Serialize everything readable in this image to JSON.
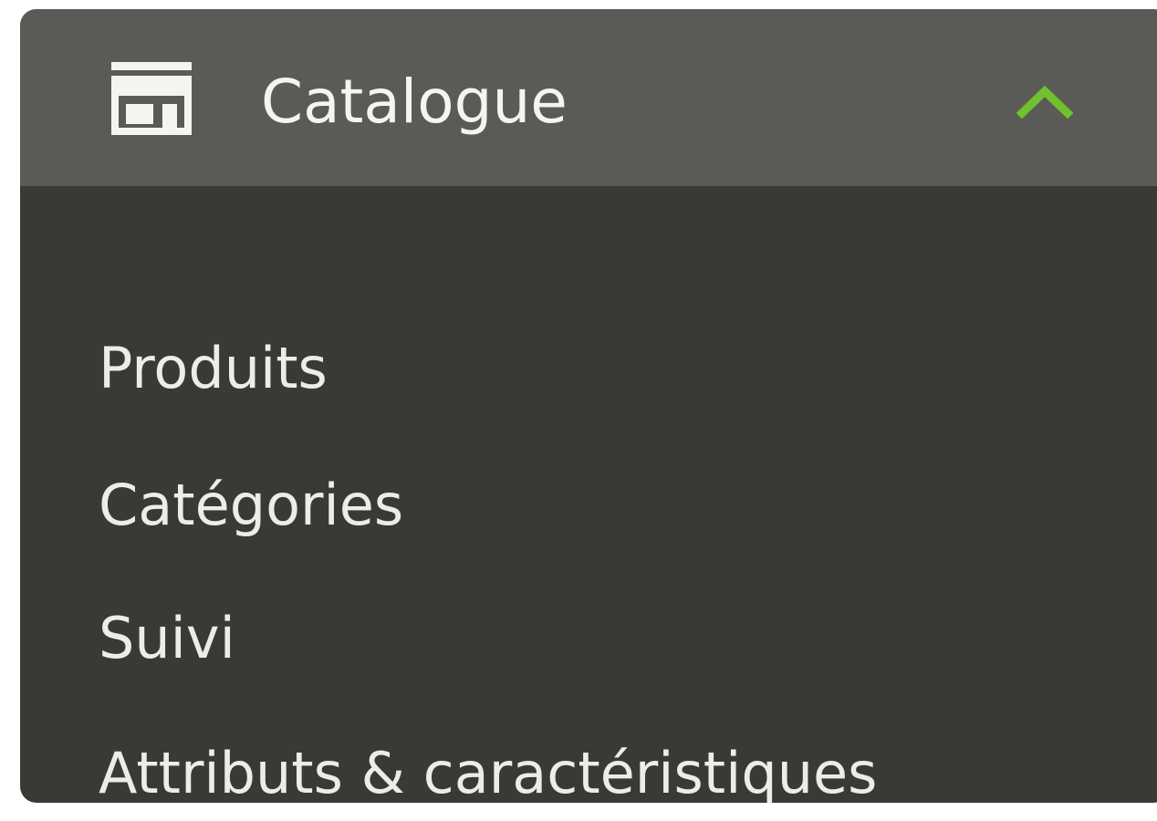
{
  "menu": {
    "header": {
      "label": "Catalogue",
      "icon": "store-icon",
      "toggle_icon": "chevron-up-icon",
      "expanded": true
    },
    "items": [
      {
        "label": "Produits"
      },
      {
        "label": "Catégories"
      },
      {
        "label": "Suivi"
      },
      {
        "label": "Attributs & caractéristiques"
      }
    ]
  },
  "colors": {
    "header_background": "#5a5b56",
    "panel_background": "#3a3a35",
    "accent": "#72c02c",
    "text": "#f4f4f1"
  }
}
